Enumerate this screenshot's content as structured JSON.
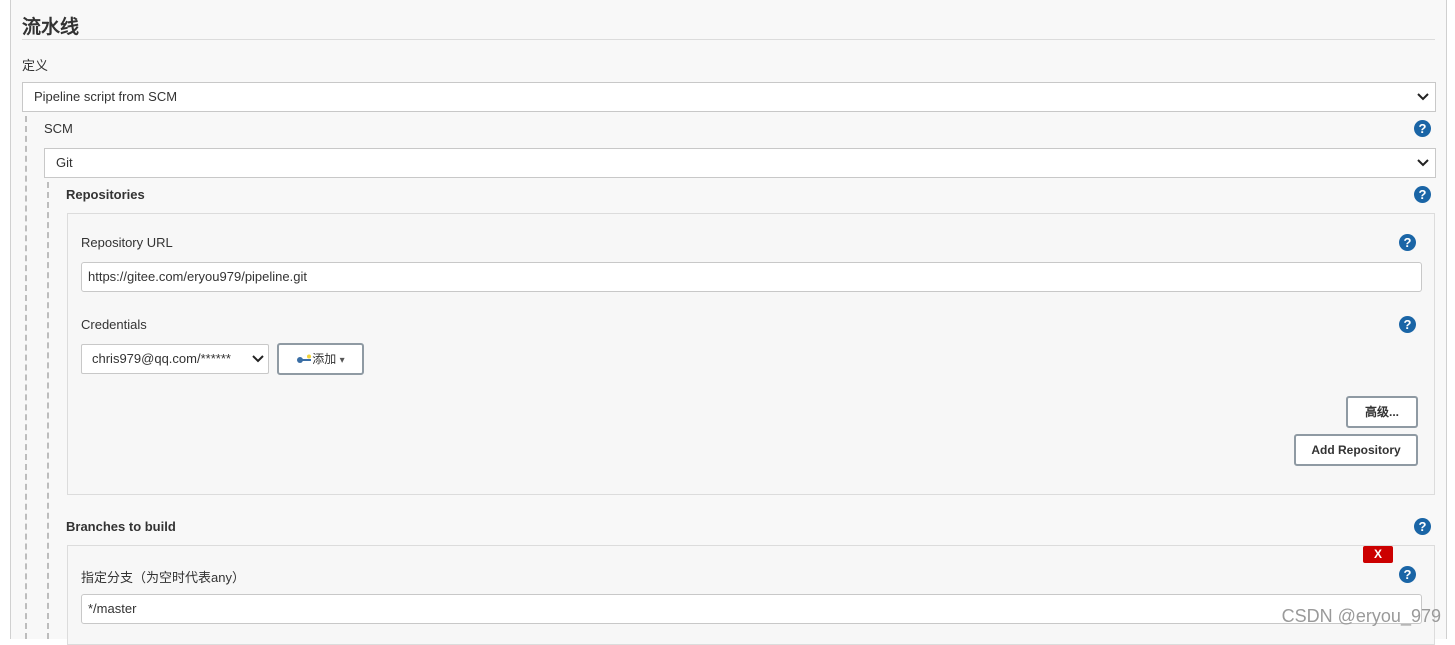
{
  "section": {
    "title": "流水线",
    "definition_label": "定义",
    "definition_value": "Pipeline script from SCM"
  },
  "scm": {
    "label": "SCM",
    "value": "Git",
    "help_icon": "?"
  },
  "repositories": {
    "label": "Repositories",
    "help_icon": "?",
    "url_label": "Repository URL",
    "url_value": "https://gitee.com/eryou979/pipeline.git",
    "credentials_label": "Credentials",
    "credentials_value": "chris979@qq.com/******",
    "add_button_label": "添加",
    "advanced_button_label": "高级...",
    "add_repository_button_label": "Add Repository"
  },
  "branches": {
    "label": "Branches to build",
    "help_icon": "?",
    "delete_button_label": "X",
    "branch_label": "指定分支（为空时代表any）",
    "branch_value": "*/master"
  },
  "icons": {
    "chevron": "⌄",
    "caret": "▾"
  },
  "watermark": "CSDN @eryou_979"
}
